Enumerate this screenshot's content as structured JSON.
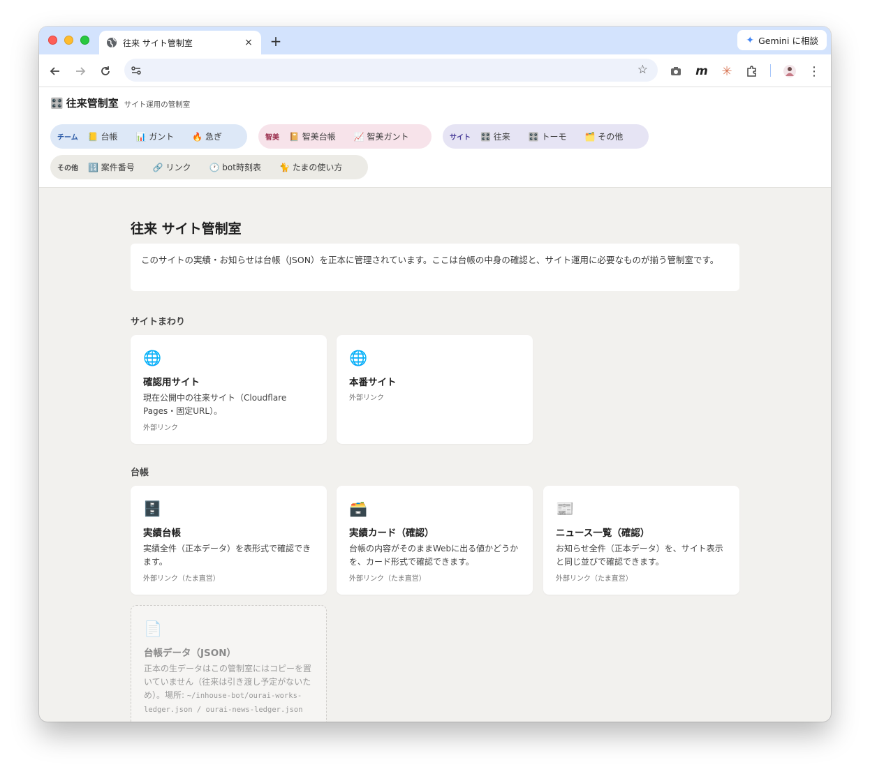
{
  "browser": {
    "tab_title": "往来 サイト管制室",
    "newtab_label": "+",
    "close_label": "×",
    "gemini_label": "Gemini に相談",
    "address_value": ""
  },
  "site": {
    "brand_icon": "🎛️",
    "brand_title": "往来管制室",
    "brand_sub": "サイト運用の管制室"
  },
  "nav": {
    "team": {
      "label": "チーム",
      "items": [
        "📒 台帳",
        "📊 ガント",
        "🔥 急ぎ"
      ]
    },
    "chibi": {
      "label": "智美",
      "items": [
        "📔 智美台帳",
        "📈 智美ガント"
      ]
    },
    "site": {
      "label": "サイト",
      "items": [
        "🎛️ 往来",
        "🎛️ トーモ",
        "🗂️ その他"
      ]
    },
    "other": {
      "label": "その他",
      "items": [
        "🔢 案件番号",
        "🔗 リンク",
        "🕐 bot時刻表",
        "🐈 たまの使い方"
      ]
    }
  },
  "main": {
    "title": "往来 サイト管制室",
    "intro": "このサイトの実績・お知らせは台帳（JSON）を正本に管理されています。ここは台帳の中身の確認と、サイト運用に必要なものが揃う管制室です。",
    "sections": [
      {
        "label": "サイトまわり",
        "cards": [
          {
            "icon": "🌐",
            "title": "確認用サイト",
            "desc": "現在公開中の往来サイト（Cloudflare Pages・固定URL）。",
            "meta": "外部リンク"
          },
          {
            "icon": "🌐",
            "title": "本番サイト",
            "desc": "",
            "meta": "外部リンク"
          }
        ]
      },
      {
        "label": "台帳",
        "cards": [
          {
            "icon": "🗄️",
            "title": "実績台帳",
            "desc": "実績全件（正本データ）を表形式で確認できます。",
            "meta": "外部リンク（たま直営）"
          },
          {
            "icon": "🗃️",
            "title": "実績カード（確認）",
            "desc": "台帳の内容がそのままWebに出る値かどうかを、カード形式で確認できます。",
            "meta": "外部リンク（たま直営）"
          },
          {
            "icon": "📰",
            "title": "ニュース一覧（確認）",
            "desc": "お知らせ全件（正本データ）を、サイト表示と同じ並びで確認できます。",
            "meta": "外部リンク（たま直営）"
          },
          {
            "icon": "📄",
            "title": "台帳データ（JSON）",
            "desc": "正本の生データはこの管制室にはコピーを置いていません（往来は引き渡し予定がないため）。場所: ",
            "path": "~/inhouse-bot/ourai-works-ledger.json / ourai-news-ledger.json",
            "disabled": true
          }
        ]
      }
    ]
  }
}
